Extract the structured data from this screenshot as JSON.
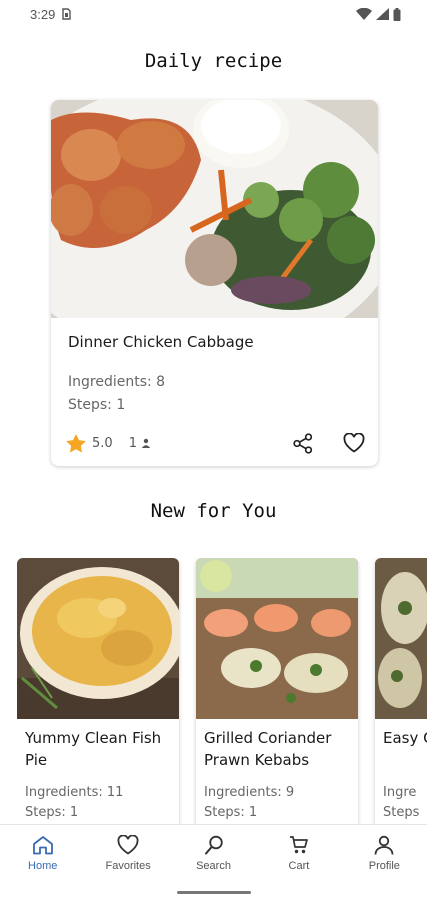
{
  "status_bar": {
    "time": "3:29"
  },
  "daily": {
    "section_title": "Daily recipe",
    "title": "Dinner Chicken Cabbage",
    "ingredients": "Ingredients: 8",
    "steps": "Steps: 1",
    "rating": "5.0",
    "reviews": "1"
  },
  "new_for_you": {
    "section_title": "New for You",
    "recipes": [
      {
        "title": "Yummy Clean Fish Pie",
        "ingredients": "Ingredients: 11",
        "steps": "Steps: 1"
      },
      {
        "title": "Grilled Coriander Prawn Kebabs",
        "ingredients": "Ingredients: 9",
        "steps": "Steps: 1"
      },
      {
        "title": "Easy Chick",
        "ingredients": "Ingre",
        "steps": "Steps"
      }
    ]
  },
  "nav": [
    {
      "label": "Home",
      "icon": "home-icon",
      "active": true
    },
    {
      "label": "Favorites",
      "icon": "heart-icon",
      "active": false
    },
    {
      "label": "Search",
      "icon": "search-icon",
      "active": false
    },
    {
      "label": "Cart",
      "icon": "cart-icon",
      "active": false
    },
    {
      "label": "Profile",
      "icon": "person-icon",
      "active": false
    }
  ],
  "colors": {
    "accent": "#3a6ab4",
    "star": "#f5a623"
  }
}
